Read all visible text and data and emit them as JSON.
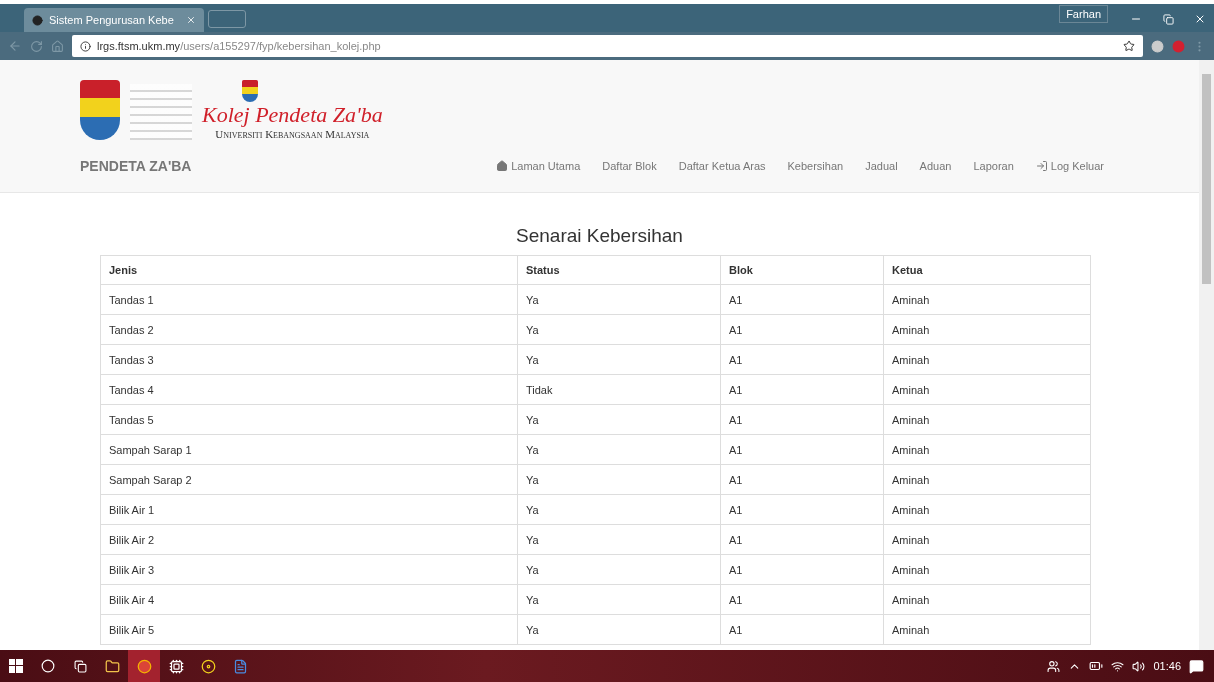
{
  "browser": {
    "tab_title": "Sistem Pengurusan Kebe",
    "profile": "Farhan",
    "url": "**lrgs.ftsm.ukm.my**/users/a155297/fyp/kebersihan_kolej.php"
  },
  "header": {
    "logo_title": "Kolej Pendeta Za'ba",
    "logo_subtitle": "Universiti Kebangsaan Malaysia"
  },
  "navbar": {
    "brand": "PENDETA ZA'BA",
    "items": [
      {
        "label": "Laman Utama",
        "kind": "home"
      },
      {
        "label": "Daftar Blok",
        "kind": "plain"
      },
      {
        "label": "Daftar Ketua Aras",
        "kind": "plain"
      },
      {
        "label": "Kebersihan",
        "kind": "plain"
      },
      {
        "label": "Jadual",
        "kind": "plain"
      },
      {
        "label": "Aduan",
        "kind": "plain"
      },
      {
        "label": "Laporan",
        "kind": "plain"
      },
      {
        "label": "Log Keluar",
        "kind": "logout"
      }
    ]
  },
  "page_title": "Senarai Kebersihan",
  "table": {
    "columns": [
      "Jenis",
      "Status",
      "Blok",
      "Ketua"
    ],
    "rows": [
      [
        "Tandas 1",
        "Ya",
        "A1",
        "Aminah"
      ],
      [
        "Tandas 2",
        "Ya",
        "A1",
        "Aminah"
      ],
      [
        "Tandas 3",
        "Ya",
        "A1",
        "Aminah"
      ],
      [
        "Tandas 4",
        "Tidak",
        "A1",
        "Aminah"
      ],
      [
        "Tandas 5",
        "Ya",
        "A1",
        "Aminah"
      ],
      [
        "Sampah Sarap 1",
        "Ya",
        "A1",
        "Aminah"
      ],
      [
        "Sampah Sarap 2",
        "Ya",
        "A1",
        "Aminah"
      ],
      [
        "Bilik Air 1",
        "Ya",
        "A1",
        "Aminah"
      ],
      [
        "Bilik Air 2",
        "Ya",
        "A1",
        "Aminah"
      ],
      [
        "Bilik Air 3",
        "Ya",
        "A1",
        "Aminah"
      ],
      [
        "Bilik Air 4",
        "Ya",
        "A1",
        "Aminah"
      ],
      [
        "Bilik Air 5",
        "Ya",
        "A1",
        "Aminah"
      ]
    ]
  },
  "taskbar": {
    "apps": [
      {
        "kind": "folder",
        "selected": false
      },
      {
        "kind": "chrome",
        "selected": true
      },
      {
        "kind": "app",
        "selected": false
      },
      {
        "kind": "disc",
        "selected": false
      },
      {
        "kind": "word",
        "selected": false
      }
    ],
    "clock": "01:46"
  }
}
